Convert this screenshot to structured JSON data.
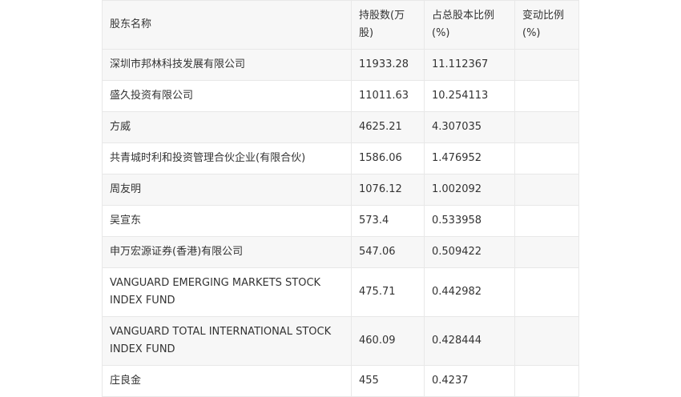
{
  "table": {
    "headers": [
      "股东名称",
      "持股数(万股)",
      "占总股本比例(%)",
      "变动比例(%)"
    ],
    "rows": [
      [
        "深圳市邦林科技发展有限公司",
        "11933.28",
        "11.112367",
        ""
      ],
      [
        "盛久投资有限公司",
        "11011.63",
        "10.254113",
        ""
      ],
      [
        "方威",
        "4625.21",
        "4.307035",
        ""
      ],
      [
        "共青城时利和投资管理合伙企业(有限合伙)",
        "1586.06",
        "1.476952",
        ""
      ],
      [
        "周友明",
        "1076.12",
        "1.002092",
        ""
      ],
      [
        "吴宣东",
        "573.4",
        "0.533958",
        ""
      ],
      [
        "申万宏源证券(香港)有限公司",
        "547.06",
        "0.509422",
        ""
      ],
      [
        "VANGUARD EMERGING MARKETS STOCK INDEX FUND",
        "475.71",
        "0.442982",
        ""
      ],
      [
        "VANGUARD TOTAL INTERNATIONAL STOCK INDEX FUND",
        "460.09",
        "0.428444",
        ""
      ],
      [
        "庄良金",
        "455",
        "0.4237",
        ""
      ]
    ]
  }
}
